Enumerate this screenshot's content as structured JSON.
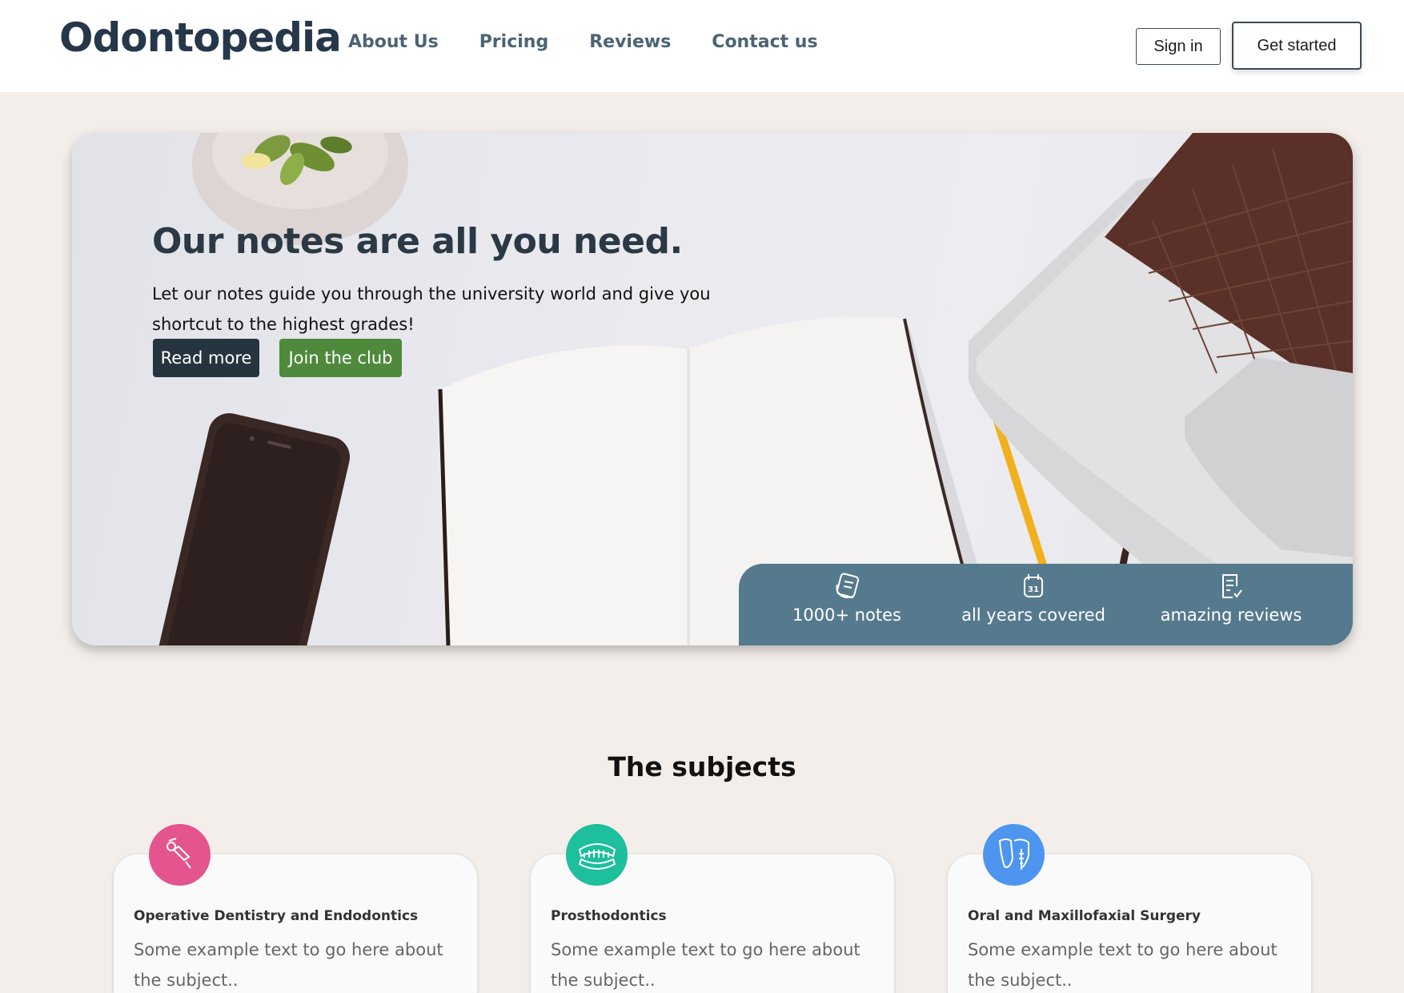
{
  "header": {
    "logo": "Odontopedia",
    "nav": [
      "About Us",
      "Pricing",
      "Reviews",
      "Contact us"
    ],
    "sign_in": "Sign in",
    "get_started": "Get started"
  },
  "hero": {
    "title": "Our notes are all you need.",
    "subtitle": "Let our notes guide you through the university world and give you shortcut to the highest grades!",
    "read_more": "Read more",
    "join": "Join the club",
    "stats": [
      {
        "label": "1000+ notes",
        "icon": "notes-icon"
      },
      {
        "label": "all years covered",
        "icon": "calendar-icon"
      },
      {
        "label": "amazing reviews",
        "icon": "review-icon"
      }
    ],
    "calendar_day": "31"
  },
  "subjects": {
    "title": "The subjects",
    "cards": [
      {
        "title": "Operative Dentistry and Endodontics",
        "text": "Some example text to go here about the subject..",
        "icon": "dental-drill-icon",
        "color": "#e4548e"
      },
      {
        "title": "Prosthodontics",
        "text": "Some example text to go here about the subject..",
        "icon": "dentures-icon",
        "color": "#1dbf9d"
      },
      {
        "title": "Oral and Maxillofaxial Surgery",
        "text": "Some example text to go here about the subject..",
        "icon": "implant-icon",
        "color": "#4d95ef"
      }
    ]
  },
  "colors": {
    "page_bg": "#f3eeea",
    "stats_bg": "#567a8d",
    "read_more_bg": "#26343f",
    "join_bg": "#4f8a3c"
  }
}
